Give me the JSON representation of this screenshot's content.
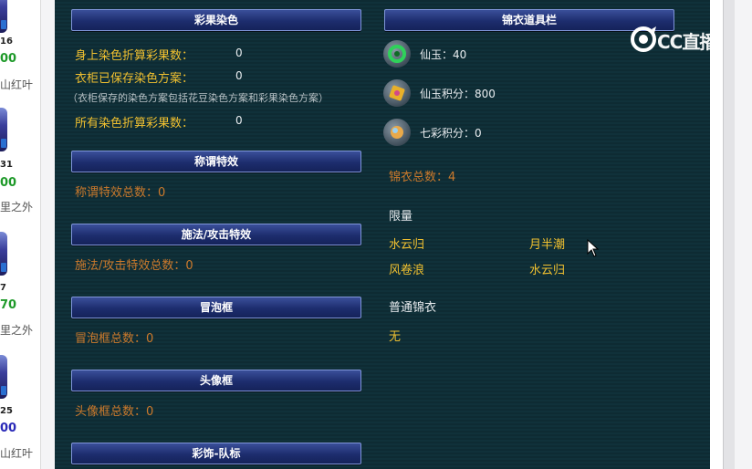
{
  "left_list": [
    {
      "num": "16",
      "score": "00",
      "score_color": "#1f9a2a",
      "name": "山红叶"
    },
    {
      "num": "31",
      "score": "00",
      "score_color": "#1f9a2a",
      "name": "里之外"
    },
    {
      "num": "7",
      "score": "70",
      "score_color": "#1f9a2a",
      "name": "里之外"
    },
    {
      "num": "25",
      "score": "00",
      "score_color": "#2a2ab8",
      "name": "山红叶"
    }
  ],
  "dye": {
    "header": "彩果染色",
    "rows": [
      {
        "label": "身上染色折算彩果数：",
        "value": "0"
      },
      {
        "label": "衣柜已保存染色方案：",
        "value": "0"
      }
    ],
    "note": "（衣柜保存的染色方案包括花豆染色方案和彩果染色方案）",
    "total_label": "所有染色折算彩果数：",
    "total_value": "0"
  },
  "title_effect": {
    "header": "称谓特效",
    "text": "称谓特效总数：0"
  },
  "cast_effect": {
    "header": "施法/攻击特效",
    "text": "施法/攻击特效总数：0"
  },
  "bubble": {
    "header": "冒泡框",
    "text": "冒泡框总数：0"
  },
  "avatar_frame": {
    "header": "头像框",
    "text": "头像框总数：0"
  },
  "decoration": {
    "header": "彩饰-队标"
  },
  "jinyi": {
    "header": "锦衣道具栏",
    "items": [
      {
        "label": "仙玉：40",
        "icon": "jade-icon"
      },
      {
        "label": "仙玉积分：800",
        "icon": "jade-points-icon"
      },
      {
        "label": "七彩积分：0",
        "icon": "rainbow-points-icon"
      }
    ],
    "total": "锦衣总数：4",
    "limited_title": "限量",
    "limited_items": [
      "水云归",
      "月半潮",
      "风卷浪",
      "水云归"
    ],
    "normal_title": "普通锦衣",
    "normal_value": "无"
  },
  "watermark": "CC直播",
  "colors": {
    "accent": "#f0c030",
    "muted": "#cc7a2c",
    "header": "#1d2d6e"
  }
}
